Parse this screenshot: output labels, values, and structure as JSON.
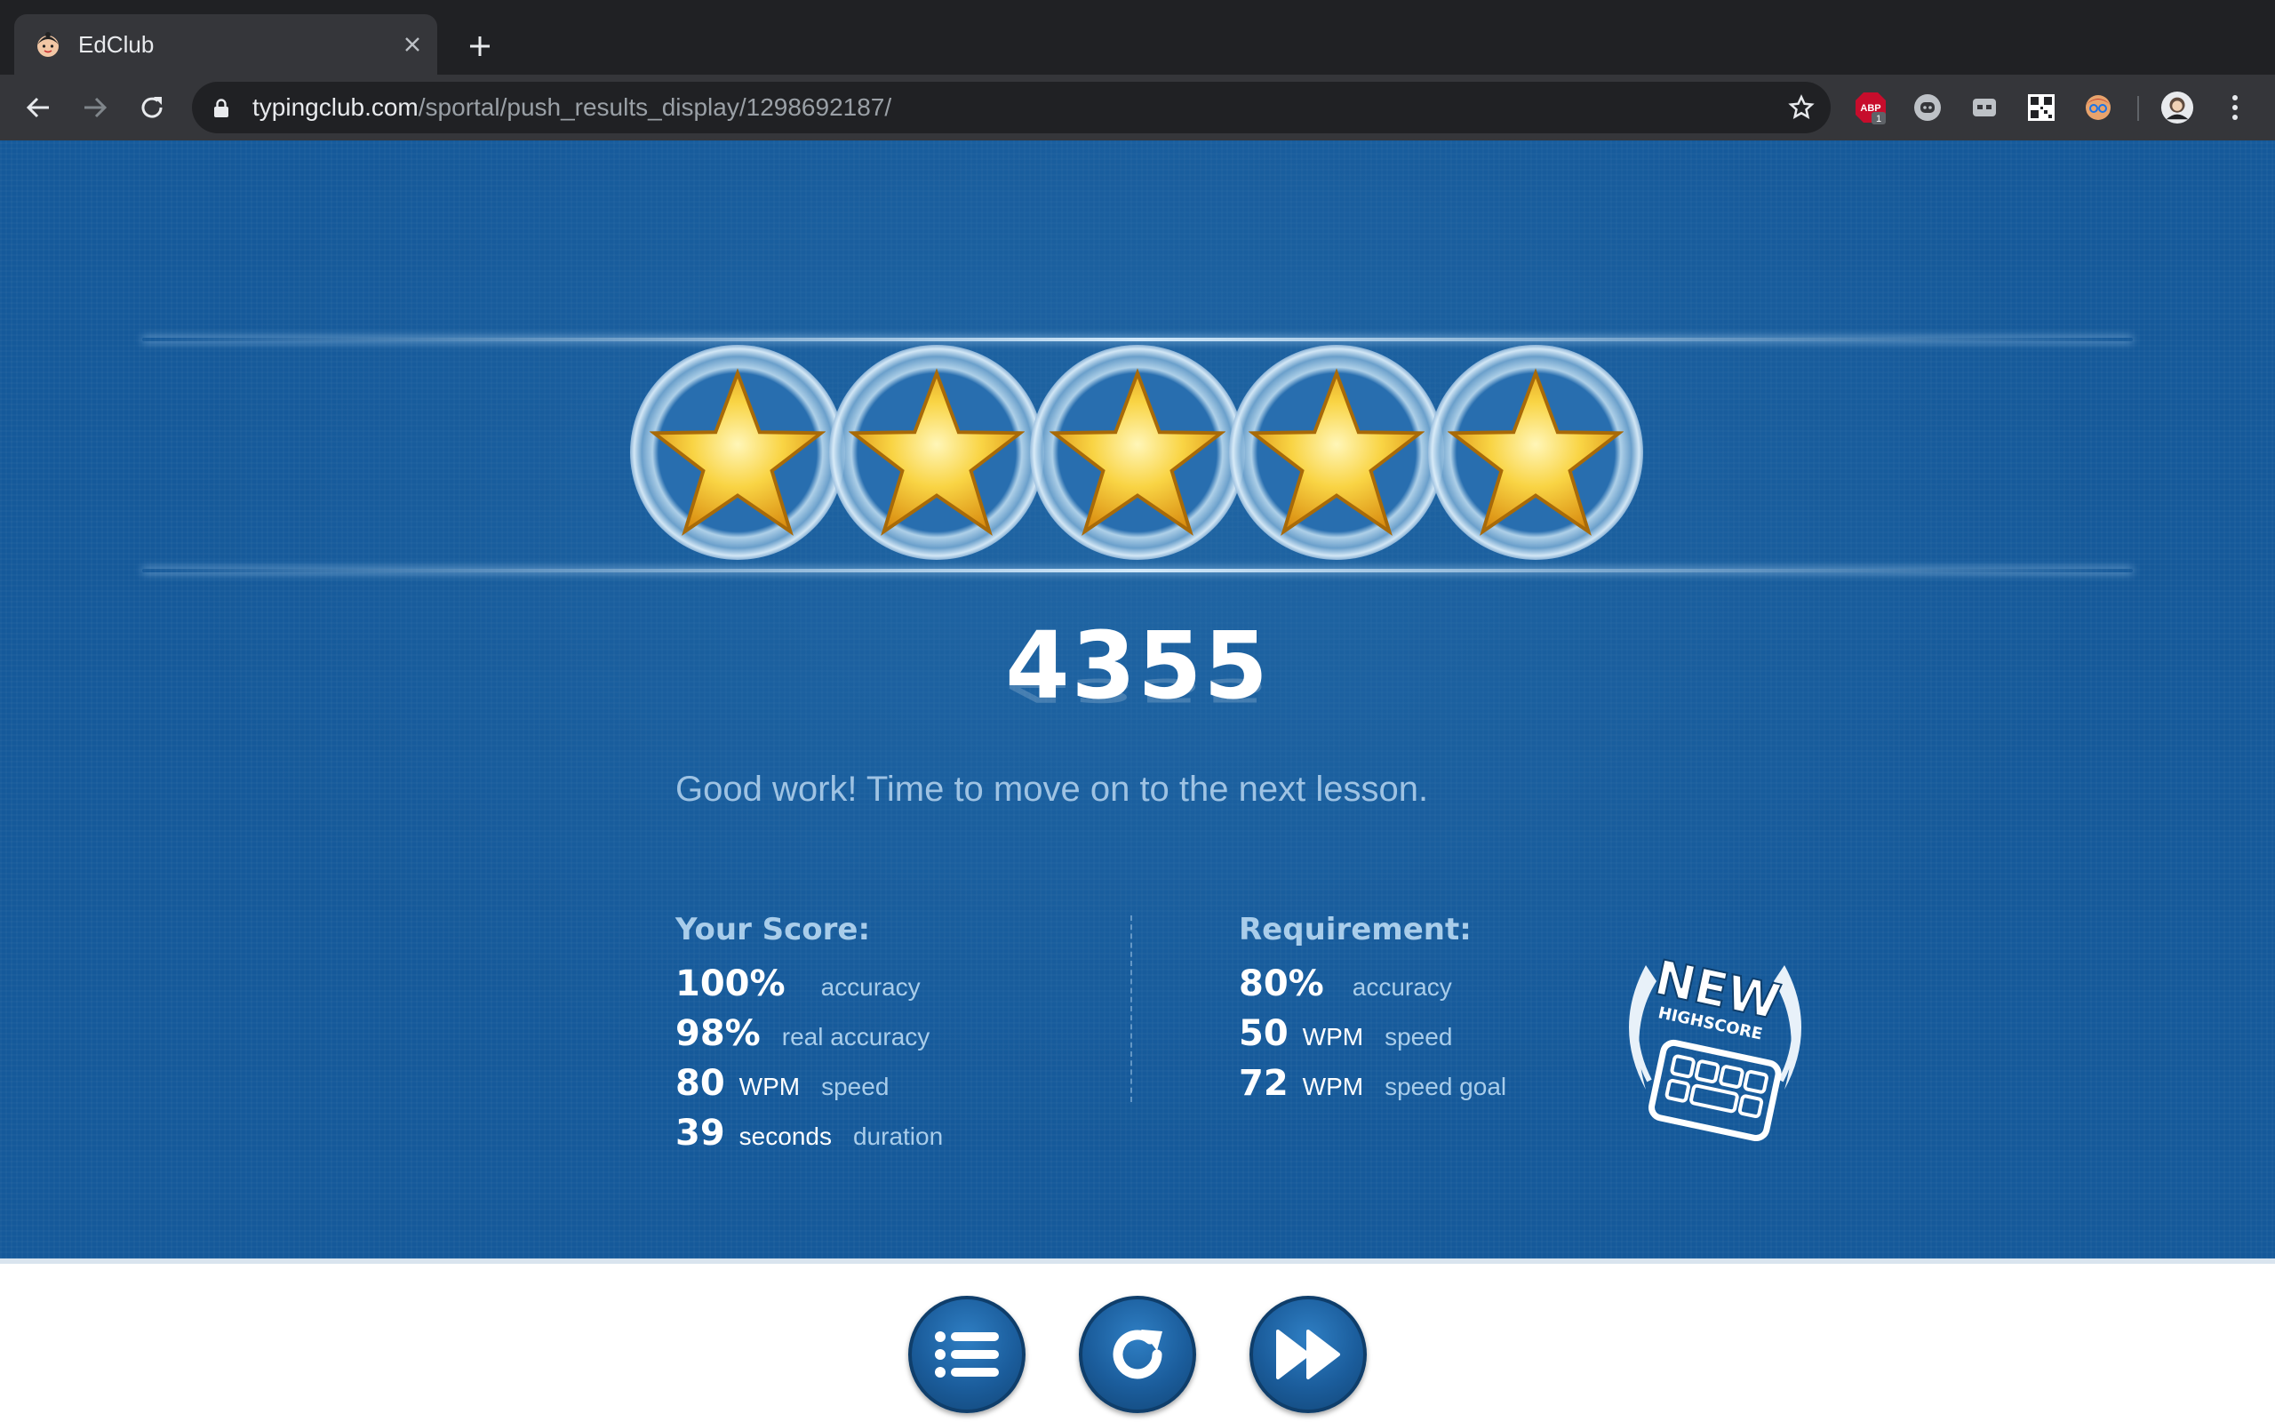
{
  "browser": {
    "tab_title": "EdClub",
    "url_host": "typingclub.com",
    "url_path": "/sportal/push_results_display/1298692187/",
    "extension_badge": "1",
    "abp_label": "ABP",
    "icons": [
      "back-icon",
      "forward-icon",
      "reload-icon",
      "lock-icon",
      "bookmark-star-icon",
      "adblock-icon",
      "discord-icon",
      "caption-icon",
      "qr-code-icon",
      "avatar-extension-icon",
      "profile-icon",
      "menu-icon"
    ]
  },
  "result": {
    "stars_earned": 5,
    "stars_total": 5,
    "score": "4355",
    "message": "Good work! Time to move on to the next lesson."
  },
  "your_score": {
    "title": "Your Score:",
    "rows": [
      {
        "value": "100%",
        "unit": "",
        "label": "accuracy"
      },
      {
        "value": "98%",
        "unit": "",
        "label": "real accuracy"
      },
      {
        "value": "80",
        "unit": "WPM",
        "label": "speed"
      },
      {
        "value": "39",
        "unit": "seconds",
        "label": "duration"
      }
    ]
  },
  "requirement": {
    "title": "Requirement:",
    "rows": [
      {
        "value": "80%",
        "unit": "",
        "label": "accuracy"
      },
      {
        "value": "50",
        "unit": "WPM",
        "label": "speed"
      },
      {
        "value": "72",
        "unit": "WPM",
        "label": "speed goal"
      }
    ]
  },
  "badge": {
    "line1": "NEW",
    "line2": "HIGHSCORE"
  },
  "actions": [
    {
      "name": "lessons-list-button",
      "icon": "list-icon"
    },
    {
      "name": "retry-button",
      "icon": "reload-icon"
    },
    {
      "name": "next-lesson-button",
      "icon": "fast-forward-icon"
    }
  ],
  "colors": {
    "panel_bg": "#15599a",
    "star_gold": "#f6c12d",
    "label_blue": "#a9cdea",
    "button_blue": "#1b5d9c"
  }
}
